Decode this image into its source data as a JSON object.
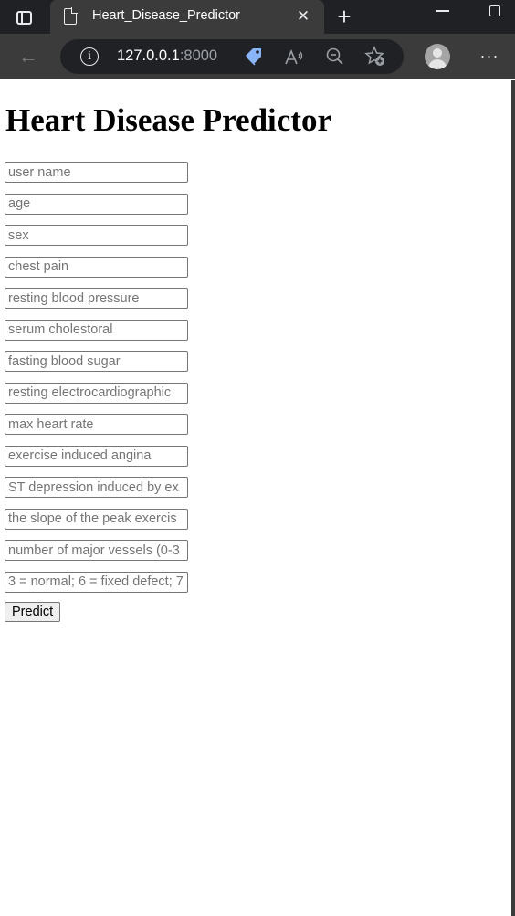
{
  "tab": {
    "title": "Heart_Disease_Predictor",
    "close_glyph": "✕",
    "new_tab_glyph": "+"
  },
  "toolbar": {
    "back_glyph": "←",
    "url_host": "127.0.0.1",
    "url_port": ":8000",
    "menu_glyph": "···"
  },
  "icons": {
    "tab_actions": "tab-actions-icon",
    "page": "page-icon",
    "info": "info-icon",
    "tag": "tag-icon",
    "read_aloud": "read-aloud-icon",
    "zoom_out": "zoom-out-icon",
    "favorites": "add-favorite-icon",
    "profile": "profile-avatar-icon"
  },
  "colors": {
    "chrome_dark": "#202124",
    "chrome_mid": "#3b3b3b",
    "tag_blue": "#8ab4f8"
  },
  "page": {
    "heading": "Heart Disease Predictor",
    "fields": [
      {
        "placeholder": "user name"
      },
      {
        "placeholder": "age"
      },
      {
        "placeholder": "sex"
      },
      {
        "placeholder": "chest pain"
      },
      {
        "placeholder": "resting blood pressure"
      },
      {
        "placeholder": "serum cholestoral"
      },
      {
        "placeholder": "fasting blood sugar"
      },
      {
        "placeholder": "resting electrocardiographic"
      },
      {
        "placeholder": "max heart rate"
      },
      {
        "placeholder": "exercise induced angina"
      },
      {
        "placeholder": "ST depression induced by ex"
      },
      {
        "placeholder": "the slope of the peak exercis"
      },
      {
        "placeholder": "number of major vessels (0-3"
      },
      {
        "placeholder": "3 = normal; 6 = fixed defect; 7"
      }
    ],
    "submit_label": "Predict"
  }
}
